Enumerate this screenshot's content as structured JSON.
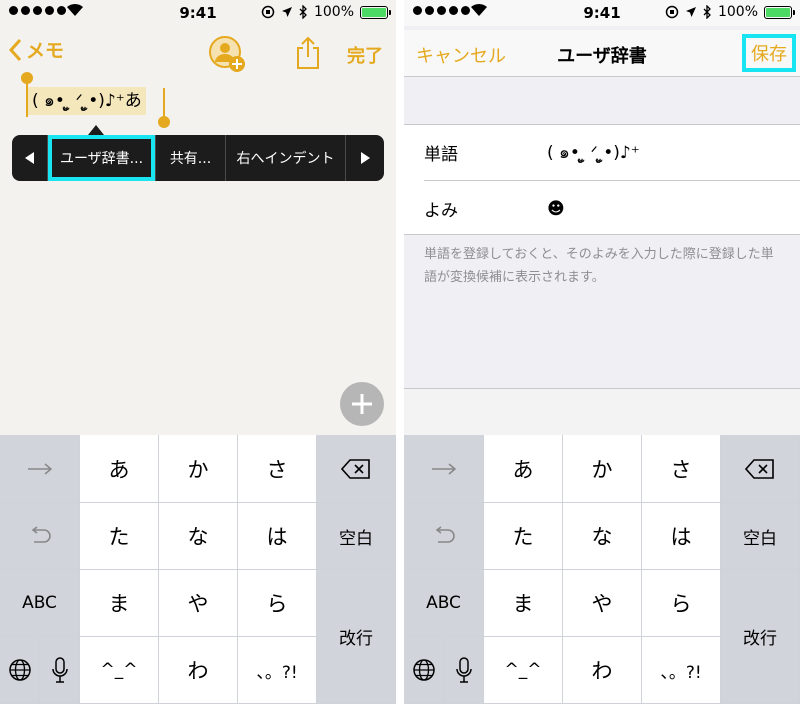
{
  "status": {
    "time": "9:41",
    "battery_percent": "100%",
    "battery_level": 1.0
  },
  "notes": {
    "back_label": "メモ",
    "done_label": "完了",
    "selected_text": "( ๑• ູ̫ ᐟ ູ̫•)♪⁺あ",
    "icons": {
      "back": "chevron-left-icon",
      "add_person": "add-person-icon",
      "share": "share-icon",
      "plus": "plus-icon"
    }
  },
  "context_menu": {
    "items": [
      "ユーザ辞書...",
      "共有...",
      "右へインデント"
    ]
  },
  "dictionary": {
    "cancel_label": "キャンセル",
    "title": "ユーザ辞書",
    "save_label": "保存",
    "word_label": "単語",
    "word_value": "( ๑• ູ̫ ᐟ ູ̫•)♪⁺",
    "reading_label": "よみ",
    "reading_value": "☻",
    "help_text": "単語を登録しておくと、そのよみを入力した際に登録した単語が変換候補に表示されます。"
  },
  "keyboard": {
    "keys": [
      "あ",
      "か",
      "さ",
      "た",
      "な",
      "は",
      "ま",
      "や",
      "ら",
      "^_^",
      "わ",
      "、。?!"
    ],
    "space_label": "空白",
    "abc_label": "ABC",
    "return_label": "改行",
    "icons": {
      "next": "right-arrow-icon",
      "undo": "undo-icon",
      "delete": "delete-icon",
      "globe": "globe-icon",
      "mic": "mic-icon"
    }
  },
  "colors": {
    "accent": "#e5a91f",
    "highlight": "#19e4f2",
    "selection": "#f5e7bc",
    "menu_bg": "#1c1c1c"
  }
}
